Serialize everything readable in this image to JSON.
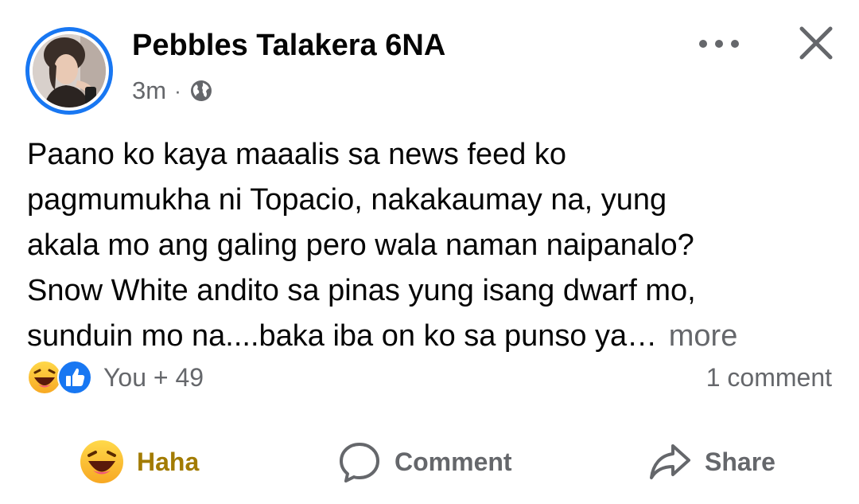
{
  "post": {
    "author": "Pebbles Talakera 6NA",
    "time": "3m",
    "separator": "·",
    "text_lines": [
      "Paano ko kaya maaalis sa news feed ko",
      "pagmumukha ni Topacio, nakakaumay na, yung",
      "akala mo ang galing pero wala naman naipanalo?",
      "Snow White andito sa pinas yung isang dwarf mo,",
      "sunduin mo na....baka iba on ko sa punso ya…"
    ],
    "more_label": "more"
  },
  "reactions": {
    "icons": [
      "haha-emoji-icon",
      "like-icon"
    ],
    "count_label": "You + 49",
    "comments_label": "1 comment"
  },
  "actions": {
    "haha_label": "Haha",
    "comment_label": "Comment",
    "share_label": "Share"
  },
  "colors": {
    "accent": "#1877f2",
    "secondary_text": "#65676b",
    "haha_text": "#a27b00",
    "primary_text": "#050505"
  }
}
